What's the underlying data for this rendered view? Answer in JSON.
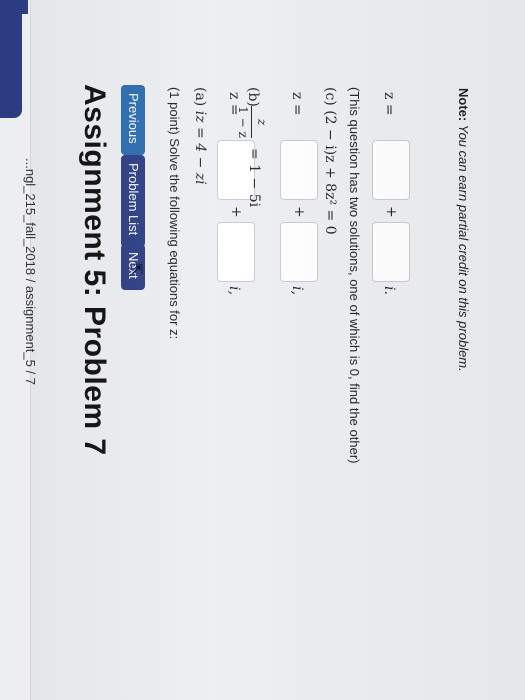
{
  "breadcrumb": "...ngl_215_fall_2018 / assignment_5 / 7",
  "title": "Assignment 5: Problem 7",
  "nav": {
    "previous": "Previous",
    "problem_list": "Problem List",
    "next": "Next"
  },
  "problem": {
    "prompt": "(1 point) Solve the following equations for z:",
    "part_a": {
      "label": "(a)",
      "equation": "iz = 4 − zi",
      "answer_label": "z =",
      "real_value": "",
      "imag_value": "",
      "plus": "+",
      "i_unit": "i,"
    },
    "part_b": {
      "label": "(b)",
      "numerator": "z",
      "denominator": "1 − z",
      "rhs": "= 1 − 5i",
      "answer_label": "z =",
      "real_value": "",
      "imag_value": "",
      "plus": "+",
      "i_unit": "i,"
    },
    "part_c": {
      "label": "(c)",
      "equation": "(2 − i)z + 8z² = 0",
      "hint": "(This question has two solutions, one of which is 0, find the other)",
      "answer_label": "z =",
      "real_value": "",
      "imag_value": "",
      "plus": "+",
      "i_unit": "i."
    }
  },
  "note": {
    "label": "Note:",
    "text": "You can earn partial credit on this problem."
  },
  "colors": {
    "nav_dark": "#2d3e86",
    "nav_light": "#2b6cb0"
  }
}
